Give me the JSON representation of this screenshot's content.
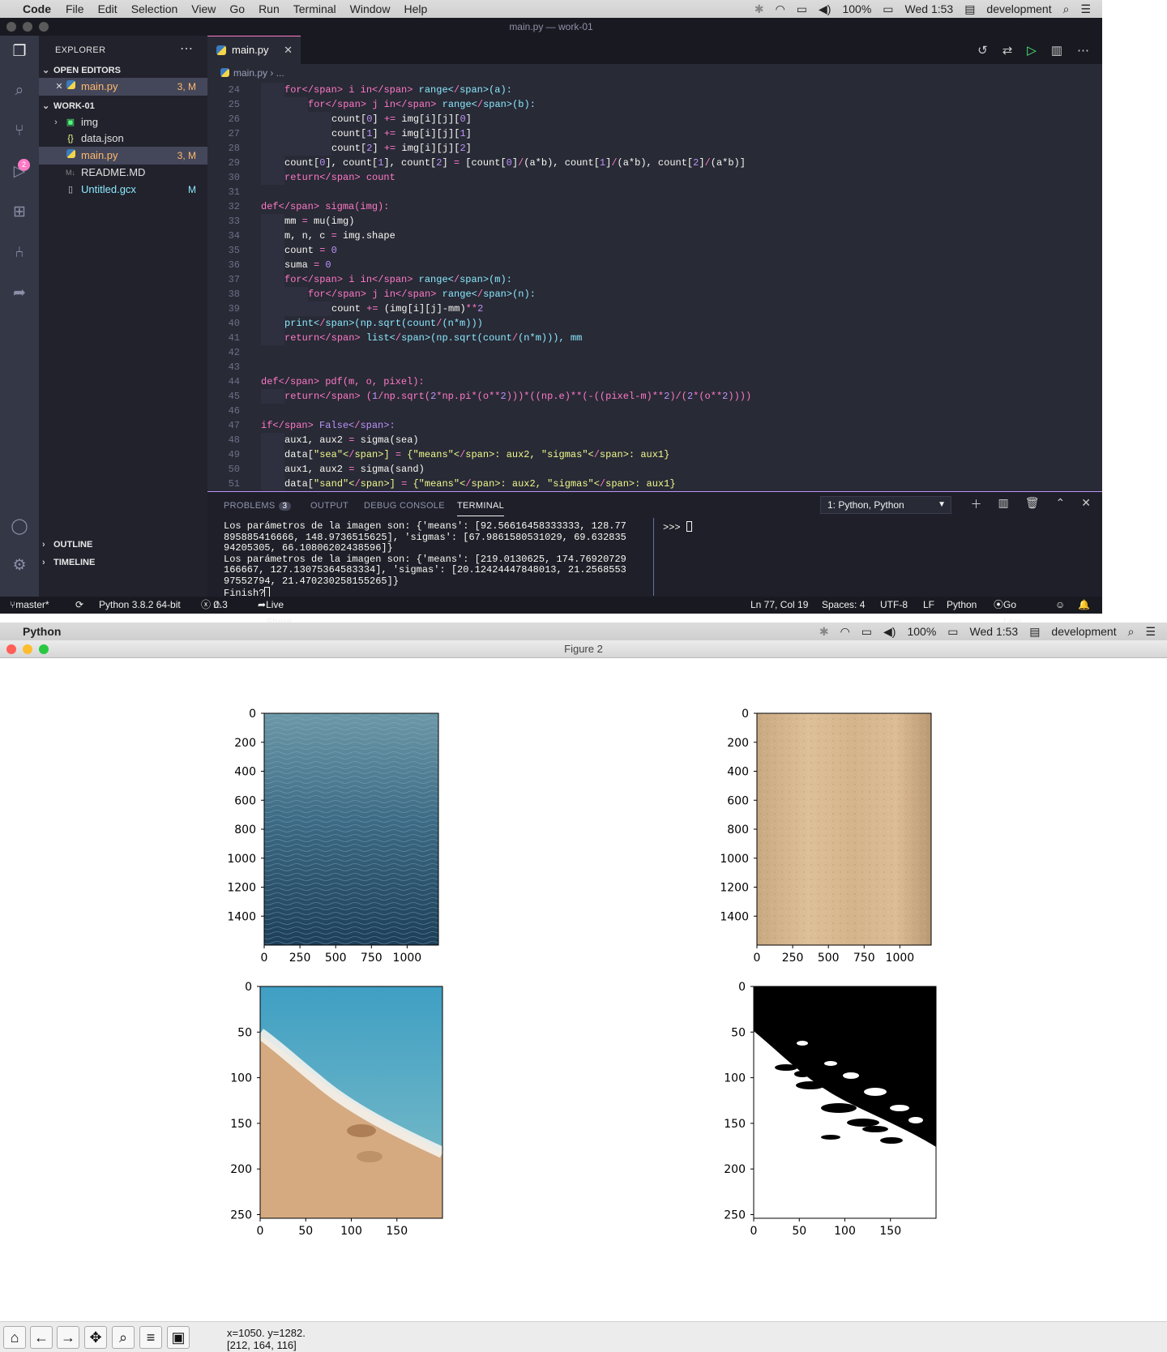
{
  "menubar": {
    "app": "Code",
    "items": [
      "File",
      "Edit",
      "Selection",
      "View",
      "Go",
      "Run",
      "Terminal",
      "Window",
      "Help"
    ],
    "battery": "100%",
    "clock": "Wed 1:53",
    "user": "development"
  },
  "menubar2": {
    "app": "Python",
    "battery": "100%",
    "clock": "Wed 1:53",
    "user": "development"
  },
  "window_title": "main.py — work-01",
  "sidebar": {
    "title": "EXPLORER",
    "open_editors_label": "OPEN EDITORS",
    "open_editor": {
      "name": "main.py",
      "status": "3, M"
    },
    "workspace_label": "WORK-01",
    "files": [
      {
        "name": "img",
        "icon": "folder-icon",
        "status": ""
      },
      {
        "name": "data.json",
        "icon": "json-icon",
        "status": ""
      },
      {
        "name": "main.py",
        "icon": "python-icon",
        "status": "3, M"
      },
      {
        "name": "README.MD",
        "icon": "markdown-icon",
        "status": ""
      },
      {
        "name": "Untitled.gcx",
        "icon": "file-icon",
        "status": "M"
      }
    ],
    "outline_label": "OUTLINE",
    "timeline_label": "TIMELINE",
    "scm_badge": "2"
  },
  "editor": {
    "tab": "main.py",
    "breadcrumb": [
      "main.py",
      "..."
    ],
    "lines": [
      {
        "n": "24",
        "indent": 1,
        "text": "for i in range(a):"
      },
      {
        "n": "25",
        "indent": 2,
        "text": "for j in range(b):"
      },
      {
        "n": "26",
        "indent": 3,
        "text": "count[0] += img[i][j][0]"
      },
      {
        "n": "27",
        "indent": 3,
        "text": "count[1] += img[i][j][1]"
      },
      {
        "n": "28",
        "indent": 3,
        "text": "count[2] += img[i][j][2]"
      },
      {
        "n": "29",
        "indent": 1,
        "text": "count[0], count[1], count[2] = [count[0]/(a*b), count[1]/(a*b), count[2]/(a*b)]"
      },
      {
        "n": "30",
        "indent": 1,
        "text": "return count"
      },
      {
        "n": "31",
        "indent": 0,
        "text": ""
      },
      {
        "n": "32",
        "indent": 0,
        "text": "def sigma(img):"
      },
      {
        "n": "33",
        "indent": 1,
        "text": "mm = mu(img)"
      },
      {
        "n": "34",
        "indent": 1,
        "text": "m, n, c = img.shape"
      },
      {
        "n": "35",
        "indent": 1,
        "text": "count = 0"
      },
      {
        "n": "36",
        "indent": 1,
        "text": "suma = 0"
      },
      {
        "n": "37",
        "indent": 1,
        "text": "for i in range(m):"
      },
      {
        "n": "38",
        "indent": 2,
        "text": "for j in range(n):"
      },
      {
        "n": "39",
        "indent": 3,
        "text": "count += (img[i][j]-mm)**2"
      },
      {
        "n": "40",
        "indent": 1,
        "text": "print(np.sqrt(count/(n*m)))"
      },
      {
        "n": "41",
        "indent": 1,
        "text": "return list(np.sqrt(count/(n*m))), mm"
      },
      {
        "n": "42",
        "indent": 0,
        "text": ""
      },
      {
        "n": "43",
        "indent": 0,
        "text": ""
      },
      {
        "n": "44",
        "indent": 0,
        "text": "def pdf(m, o, pixel):"
      },
      {
        "n": "45",
        "indent": 1,
        "text": "return (1/np.sqrt(2*np.pi*(o**2)))*((np.e)**(-((pixel-m)**2)/(2*(o**2))))"
      },
      {
        "n": "46",
        "indent": 0,
        "text": ""
      },
      {
        "n": "47",
        "indent": 0,
        "text": "if False:"
      },
      {
        "n": "48",
        "indent": 1,
        "text": "aux1, aux2 = sigma(sea)"
      },
      {
        "n": "49",
        "indent": 1,
        "text": "data[\"sea\"] = {\"means\": aux2, \"sigmas\": aux1}"
      },
      {
        "n": "50",
        "indent": 1,
        "text": "aux1, aux2 = sigma(sand)"
      },
      {
        "n": "51",
        "indent": 1,
        "text": "data[\"sand\"] = {\"means\": aux2, \"sigmas\": aux1}"
      }
    ]
  },
  "panel": {
    "tabs": [
      "PROBLEMS",
      "OUTPUT",
      "DEBUG CONSOLE",
      "TERMINAL"
    ],
    "problems_count": "3",
    "terminal_select": "1: Python, Python",
    "terminal_output": "Los parámetros de la imagen son: {'means': [92.56616458333333, 128.77895885416666, 148.9736515625], 'sigmas': [67.9861580531029, 69.63283594205305, 66.10806202438596]}\nLos parámetros de la imagen son: {'means': [219.0130625, 174.76920729166667, 127.13075364583334], 'sigmas': [20.12424447848013, 21.256855397552794, 21.470230258155265]}\nFinish?",
    "terminal2": ">>> "
  },
  "statusbar": {
    "branch": "master*",
    "python": "Python 3.8.2 64-bit",
    "errors": "0",
    "warnings": "3",
    "liveshare": "Live Share",
    "position": "Ln 77, Col 19",
    "spaces": "Spaces: 4",
    "encoding": "UTF-8",
    "eol": "LF",
    "language": "Python",
    "golive": "Go Live"
  },
  "figure": {
    "title": "Figure 2",
    "coords_line1": "x=1050. y=1282.",
    "coords_line2": "[212, 164, 116]"
  },
  "chart_data": [
    {
      "type": "image",
      "title": "",
      "xticks": [
        "0",
        "250",
        "500",
        "750",
        "1000"
      ],
      "yticks": [
        "0",
        "200",
        "400",
        "600",
        "800",
        "1000",
        "1200",
        "1400"
      ],
      "content": "sea water"
    },
    {
      "type": "image",
      "title": "",
      "xticks": [
        "0",
        "250",
        "500",
        "750",
        "1000"
      ],
      "yticks": [
        "0",
        "200",
        "400",
        "600",
        "800",
        "1000",
        "1200",
        "1400"
      ],
      "content": "sand"
    },
    {
      "type": "image",
      "title": "",
      "xticks": [
        "0",
        "50",
        "100",
        "150"
      ],
      "yticks": [
        "0",
        "50",
        "100",
        "150",
        "200",
        "250"
      ],
      "content": "beach shoreline"
    },
    {
      "type": "image",
      "title": "",
      "xticks": [
        "0",
        "50",
        "100",
        "150"
      ],
      "yticks": [
        "0",
        "50",
        "100",
        "150",
        "200",
        "250"
      ],
      "content": "binary segmentation mask"
    }
  ],
  "colors": {
    "accent": "#ff79c6",
    "green": "#50fa7b",
    "editor_bg": "#282a36"
  }
}
